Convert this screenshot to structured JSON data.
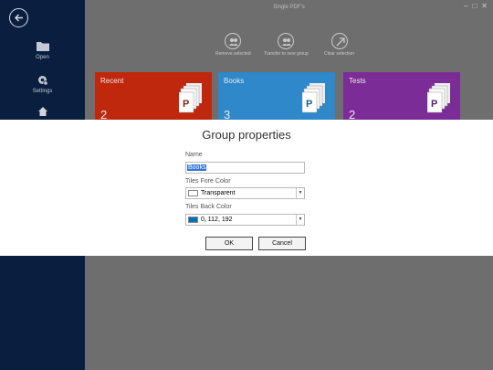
{
  "window": {
    "title": "Single PDF's"
  },
  "sidebar": {
    "back_icon": "back-arrow-icon",
    "items": [
      {
        "label": "Open",
        "icon": "folder-icon"
      },
      {
        "label": "Settings",
        "icon": "settings-gear-icon"
      },
      {
        "label": "",
        "icon": "home-icon"
      }
    ]
  },
  "toolbar": {
    "remove_selected": "Remove selected",
    "transfer_to_new_group": "Transfer to new group",
    "clear_selection": "Clear selection"
  },
  "tiles": [
    {
      "name": "Recent",
      "count": "2",
      "color": "#c0280e"
    },
    {
      "name": "Books",
      "count": "3",
      "color": "#2e88c9"
    },
    {
      "name": "Tests",
      "count": "2",
      "color": "#7c2c96"
    }
  ],
  "dialog": {
    "title": "Group properties",
    "name_label": "Name",
    "name_value": "Books",
    "fore_label": "Tiles Fore Color",
    "fore_value": "Transparent",
    "fore_swatch": "#ffffff",
    "back_label": "Tiles Back Color",
    "back_value": "0, 112, 192",
    "back_swatch": "#0070c0",
    "ok_label": "OK",
    "cancel_label": "Cancel"
  }
}
